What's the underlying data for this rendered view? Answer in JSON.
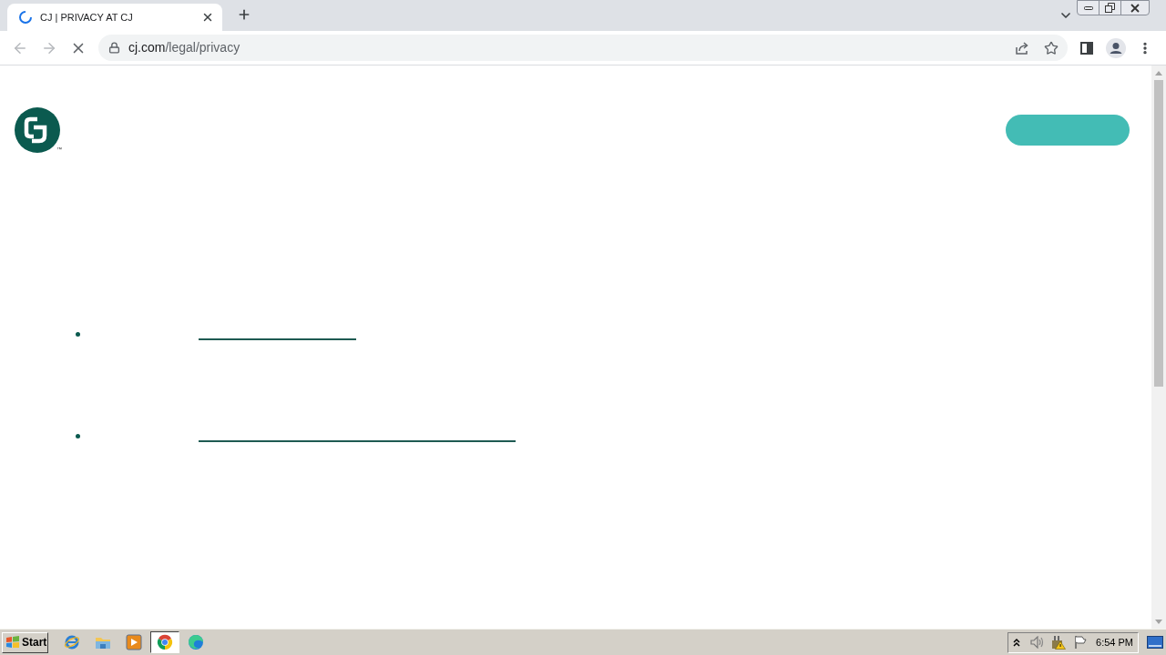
{
  "browser": {
    "tabs": [
      {
        "title": "CJ | PRIVACY AT CJ",
        "selected": true,
        "loading": true
      }
    ],
    "address": {
      "host": "cj.com",
      "path": "/legal/privacy"
    }
  },
  "page": {
    "logo": {
      "trademark": "™"
    }
  },
  "taskbar": {
    "start": "Start",
    "apps": [
      {
        "kind": "ie",
        "selected": false
      },
      {
        "kind": "explorer",
        "selected": false
      },
      {
        "kind": "media",
        "selected": false
      },
      {
        "kind": "chrome",
        "selected": true
      },
      {
        "kind": "edge",
        "selected": false
      }
    ],
    "clock": "6:54 PM"
  }
}
